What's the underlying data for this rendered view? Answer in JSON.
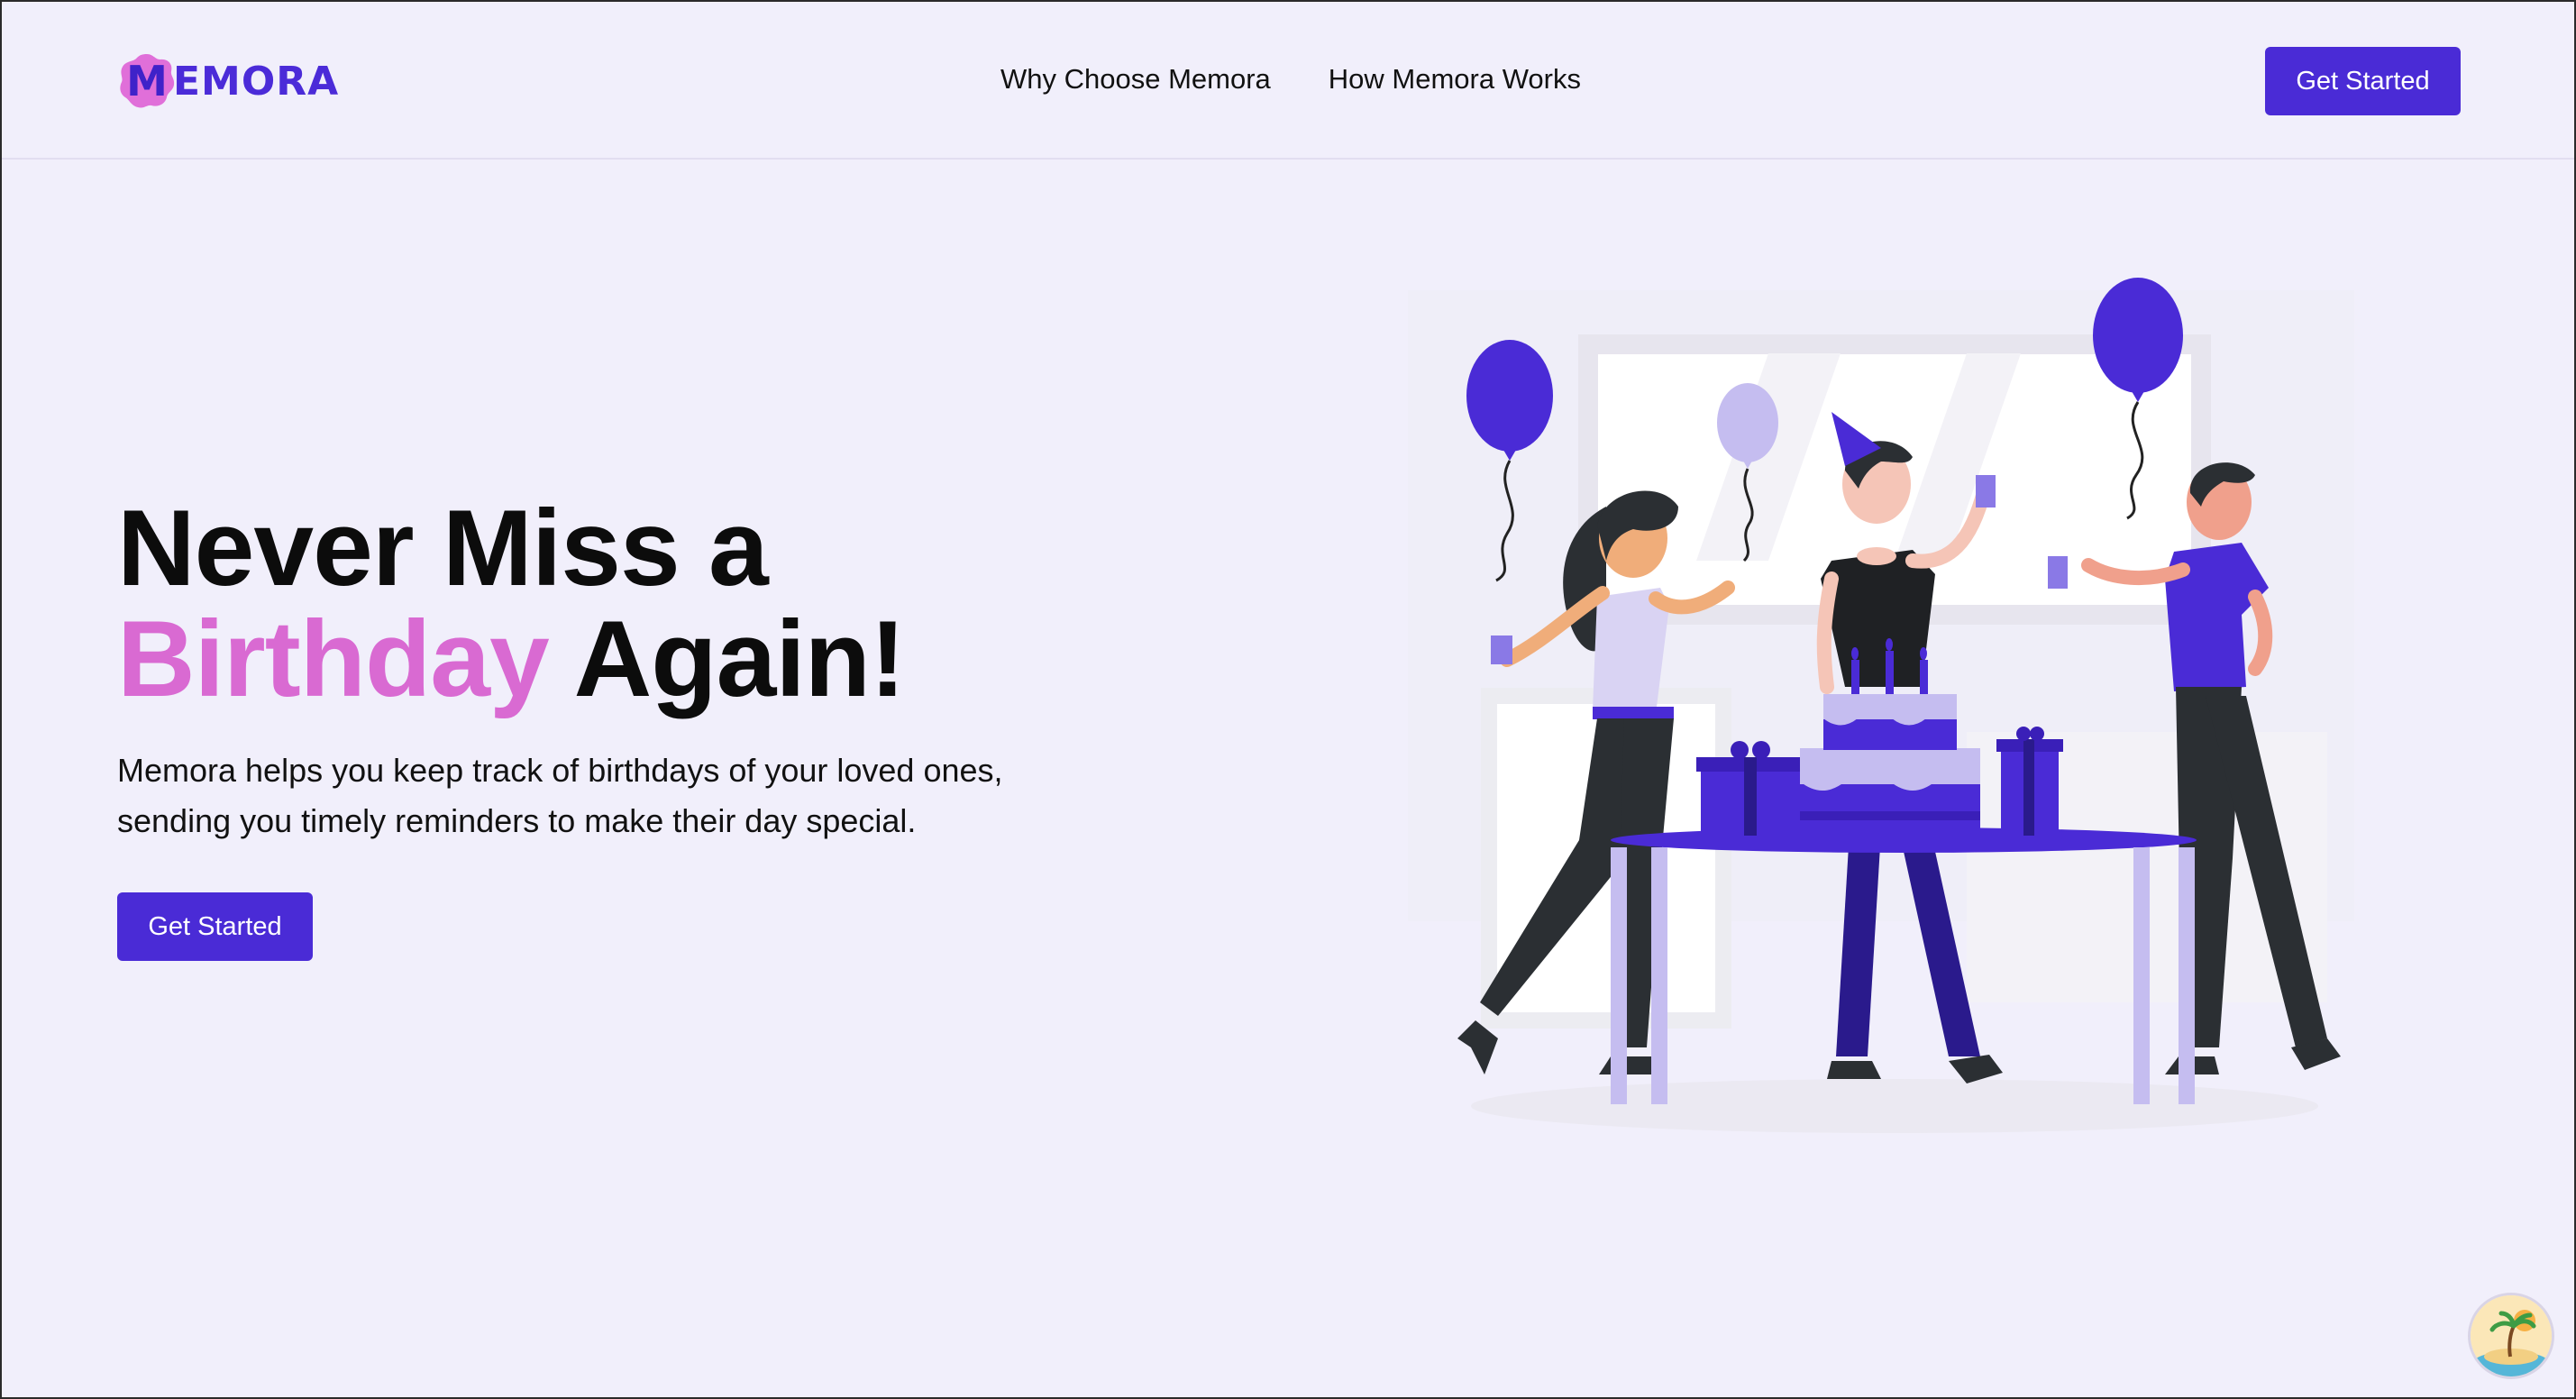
{
  "brand": {
    "logo_initial": "M",
    "logo_rest": "EMORA",
    "logo_badge_color": "#e06fd9",
    "logo_text_color": "#4b2bd8"
  },
  "nav": {
    "items": [
      "Why Choose Memora",
      "How Memora Works"
    ],
    "cta_label": "Get Started"
  },
  "hero": {
    "title_line1": "Never Miss a",
    "title_accent": "Birthday",
    "title_end": "Again!",
    "subtitle_line1": "Memora helps you keep track of birthdays of your loved ones,",
    "subtitle_line2": "sending you timely reminders to make their day special.",
    "cta_label": "Get Started"
  },
  "colors": {
    "background": "#f1effb",
    "primary": "#4a2bd6",
    "accent_pink": "#d96ad2",
    "lavender": "#c5bdf0"
  },
  "icons": {
    "illustration": "birthday-party-illustration",
    "avatar": "beach-avatar-icon"
  }
}
